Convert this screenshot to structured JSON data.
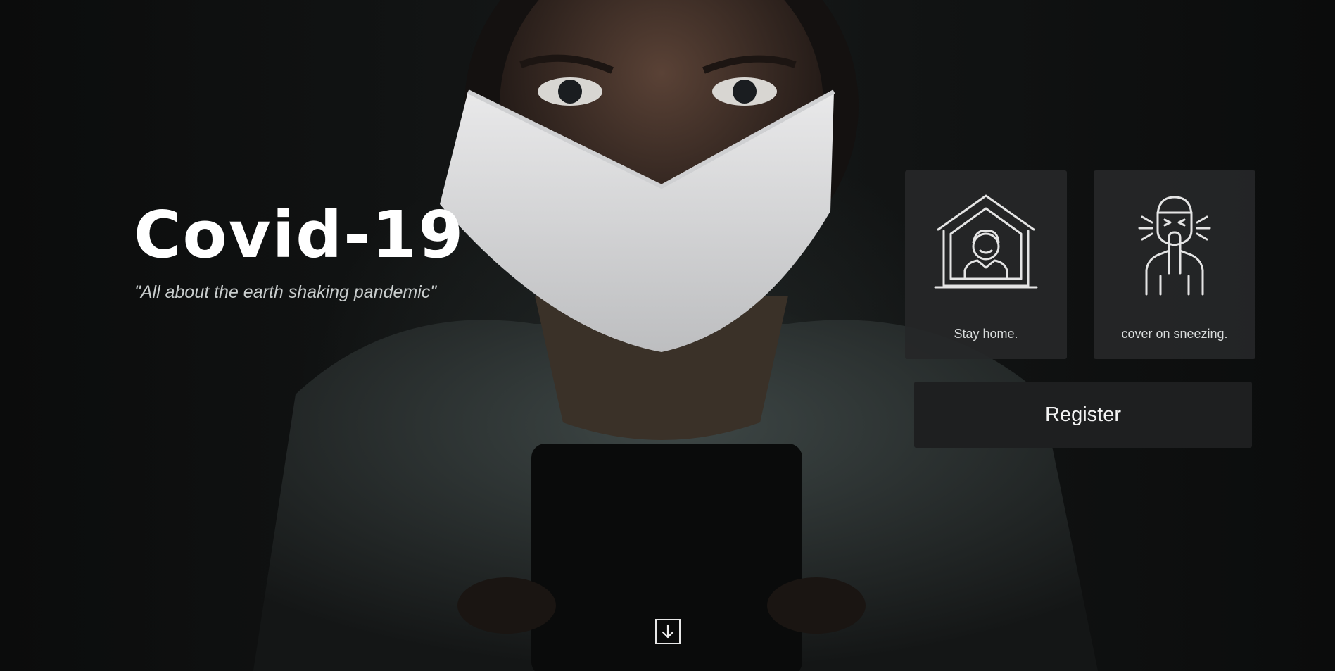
{
  "hero": {
    "title": "Covid-19",
    "subtitle": "\"All about the earth shaking pandemic\""
  },
  "cards": [
    {
      "label": "Stay home.",
      "icon": "house-person-icon"
    },
    {
      "label": "cover on sneezing.",
      "icon": "sneezing-person-icon"
    }
  ],
  "register": {
    "label": "Register"
  },
  "scroll": {
    "icon": "arrow-down-icon"
  },
  "colors": {
    "background": "#0c0d0d",
    "card": "#262728",
    "button": "#1e1f20",
    "text": "#ffffff"
  }
}
